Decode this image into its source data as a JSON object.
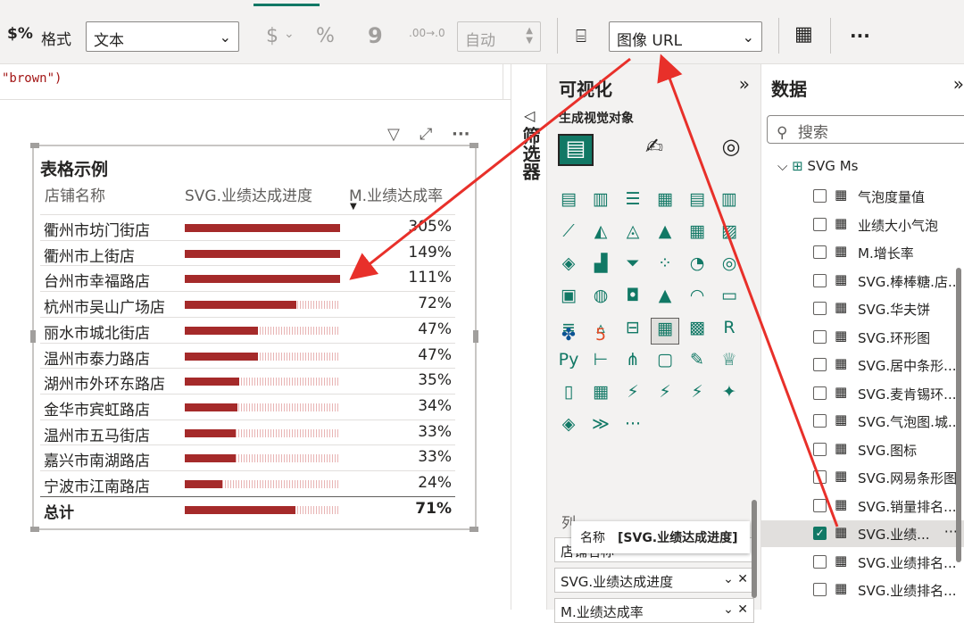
{
  "ribbon": {
    "format_label": "格式",
    "format_value": "文本",
    "currency": "$",
    "percent": "%",
    "comma": "9",
    "decimal": ".00→.0",
    "auto_value": "自动",
    "category_value": "图像 URL",
    "more": "···"
  },
  "formula": {
    "code": "\"brown\")"
  },
  "visual": {
    "title": "表格示例",
    "headers": [
      "店铺名称",
      "SVG.业绩达成进度",
      "M.业绩达成率"
    ],
    "rows": [
      {
        "name": "衢州市坊门街店",
        "value": "305%",
        "progress": 1.0
      },
      {
        "name": "衢州市上街店",
        "value": "149%",
        "progress": 1.0
      },
      {
        "name": "台州市幸福路店",
        "value": "111%",
        "progress": 1.0
      },
      {
        "name": "杭州市吴山广场店",
        "value": "72%",
        "progress": 0.72
      },
      {
        "name": "丽水市城北街店",
        "value": "47%",
        "progress": 0.47
      },
      {
        "name": "温州市泰力路店",
        "value": "47%",
        "progress": 0.47
      },
      {
        "name": "湖州市外环东路店",
        "value": "35%",
        "progress": 0.35
      },
      {
        "name": "金华市宾虹路店",
        "value": "34%",
        "progress": 0.34
      },
      {
        "name": "温州市五马街店",
        "value": "33%",
        "progress": 0.33
      },
      {
        "name": "嘉兴市南湖路店",
        "value": "33%",
        "progress": 0.33
      },
      {
        "name": "宁波市江南路店",
        "value": "24%",
        "progress": 0.24
      }
    ],
    "total": {
      "name": "总计",
      "value": "71%",
      "progress": 0.71
    }
  },
  "filter_pane": {
    "label": "筛选器"
  },
  "viz_pane": {
    "title": "可视化",
    "subtitle": "生成视觉对象",
    "wells_label": "列",
    "wells": [
      "店铺名称",
      "SVG.业绩达成进度",
      "M.业绩达成率"
    ]
  },
  "tooltip": {
    "label": "名称",
    "value": "[SVG.业绩达成进度]"
  },
  "data_pane": {
    "title": "数据",
    "search_placeholder": "搜索",
    "table_name": "SVG Ms",
    "fields": [
      {
        "label": "气泡度量值",
        "checked": false
      },
      {
        "label": "业绩大小气泡",
        "checked": false
      },
      {
        "label": "M.增长率",
        "checked": false
      },
      {
        "label": "SVG.棒棒糖.店...",
        "checked": false
      },
      {
        "label": "SVG.华夫饼",
        "checked": false
      },
      {
        "label": "SVG.环形图",
        "checked": false
      },
      {
        "label": "SVG.居中条形...",
        "checked": false
      },
      {
        "label": "SVG.麦肯锡环...",
        "checked": false
      },
      {
        "label": "SVG.气泡图.城...",
        "checked": false
      },
      {
        "label": "SVG.图标",
        "checked": false
      },
      {
        "label": "SVG.网易条形图",
        "checked": false
      },
      {
        "label": "SVG.销量排名...",
        "checked": false
      },
      {
        "label": "SVG.业绩...",
        "checked": true
      },
      {
        "label": "SVG.业绩排名...",
        "checked": false
      },
      {
        "label": "SVG.业绩排名...",
        "checked": false
      }
    ]
  },
  "colors": {
    "accent": "#117865",
    "bar": "#a52a2a",
    "arrow": "#e8302a"
  }
}
